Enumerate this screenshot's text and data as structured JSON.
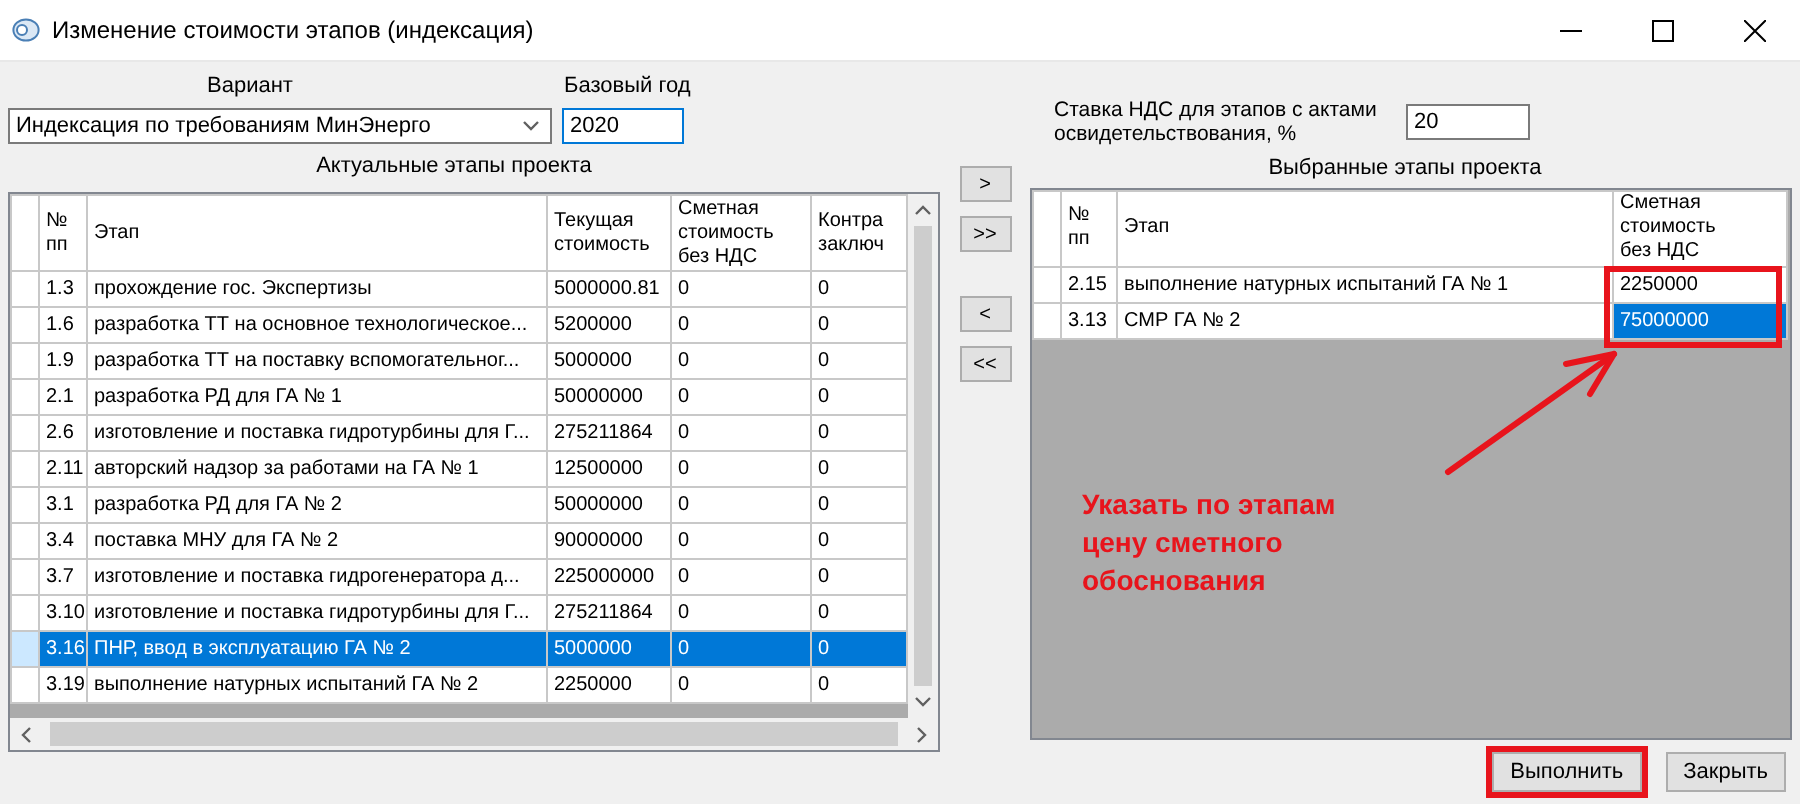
{
  "window": {
    "title": "Изменение стоимости этапов (индексация)"
  },
  "variant": {
    "label": "Вариант",
    "value": "Индексация по требованиям МинЭнерго"
  },
  "base_year": {
    "label": "Базовый год",
    "value": "2020"
  },
  "vat_rate": {
    "label": "Ставка НДС для этапов с актами освидетельствования, %",
    "value": "20"
  },
  "actual_stages": {
    "title": "Актуальные этапы проекта",
    "columns": [
      "№\nпп",
      "Этап",
      "Текущая\nстоимость",
      "Сметная\nстоимость\nбез НДС",
      "Контра\nзаключ"
    ],
    "rows": [
      {
        "cells": [
          "1.3",
          "прохождение гос. Экспертизы",
          "5000000.81",
          "0",
          "0"
        ],
        "selected": false
      },
      {
        "cells": [
          "1.6",
          "разработка ТТ на основное технологическое...",
          "5200000",
          "0",
          "0"
        ],
        "selected": false
      },
      {
        "cells": [
          "1.9",
          "разработка ТТ на поставку вспомогательног...",
          "5000000",
          "0",
          "0"
        ],
        "selected": false
      },
      {
        "cells": [
          "2.1",
          "разработка РД для ГА № 1",
          "50000000",
          "0",
          "0"
        ],
        "selected": false
      },
      {
        "cells": [
          "2.6",
          "изготовление и поставка гидротурбины для Г...",
          "275211864",
          "0",
          "0"
        ],
        "selected": false
      },
      {
        "cells": [
          "2.11",
          "авторский надзор за работами на ГА № 1",
          "12500000",
          "0",
          "0"
        ],
        "selected": false
      },
      {
        "cells": [
          "3.1",
          "разработка РД для ГА № 2",
          "50000000",
          "0",
          "0"
        ],
        "selected": false
      },
      {
        "cells": [
          "3.4",
          "поставка МНУ для ГА № 2",
          "90000000",
          "0",
          "0"
        ],
        "selected": false
      },
      {
        "cells": [
          "3.7",
          "изготовление и поставка гидрогенератора д...",
          "225000000",
          "0",
          "0"
        ],
        "selected": false
      },
      {
        "cells": [
          "3.10",
          "изготовление и поставка гидротурбины для Г...",
          "275211864",
          "0",
          "0"
        ],
        "selected": false
      },
      {
        "cells": [
          "3.16",
          "ПНР, ввод в эксплуатацию ГА № 2",
          "5000000",
          "0",
          "0"
        ],
        "selected": true
      },
      {
        "cells": [
          "3.19",
          "выполнение натурных испытаний ГА № 2",
          "2250000",
          "0",
          "0"
        ],
        "selected": false
      }
    ]
  },
  "transfer_buttons": [
    ">",
    ">>",
    "<",
    "<<"
  ],
  "selected_stages": {
    "title": "Выбранные этапы проекта",
    "columns": [
      "№\nпп",
      "Этап",
      "Сметная\nстоимость\nбез НДС"
    ],
    "rows": [
      {
        "cells": [
          "2.15",
          "выполнение натурных испытаний ГА № 1",
          "2250000"
        ],
        "selected": false
      },
      {
        "cells": [
          "3.13",
          "СМР ГА № 2",
          "75000000"
        ],
        "selected": true
      }
    ]
  },
  "annotation": {
    "text": "Указать по этапам цену сметного обоснования"
  },
  "buttons": [
    {
      "label": "Выполнить",
      "highlighted": true
    },
    {
      "label": "Закрыть",
      "highlighted": false
    }
  ]
}
